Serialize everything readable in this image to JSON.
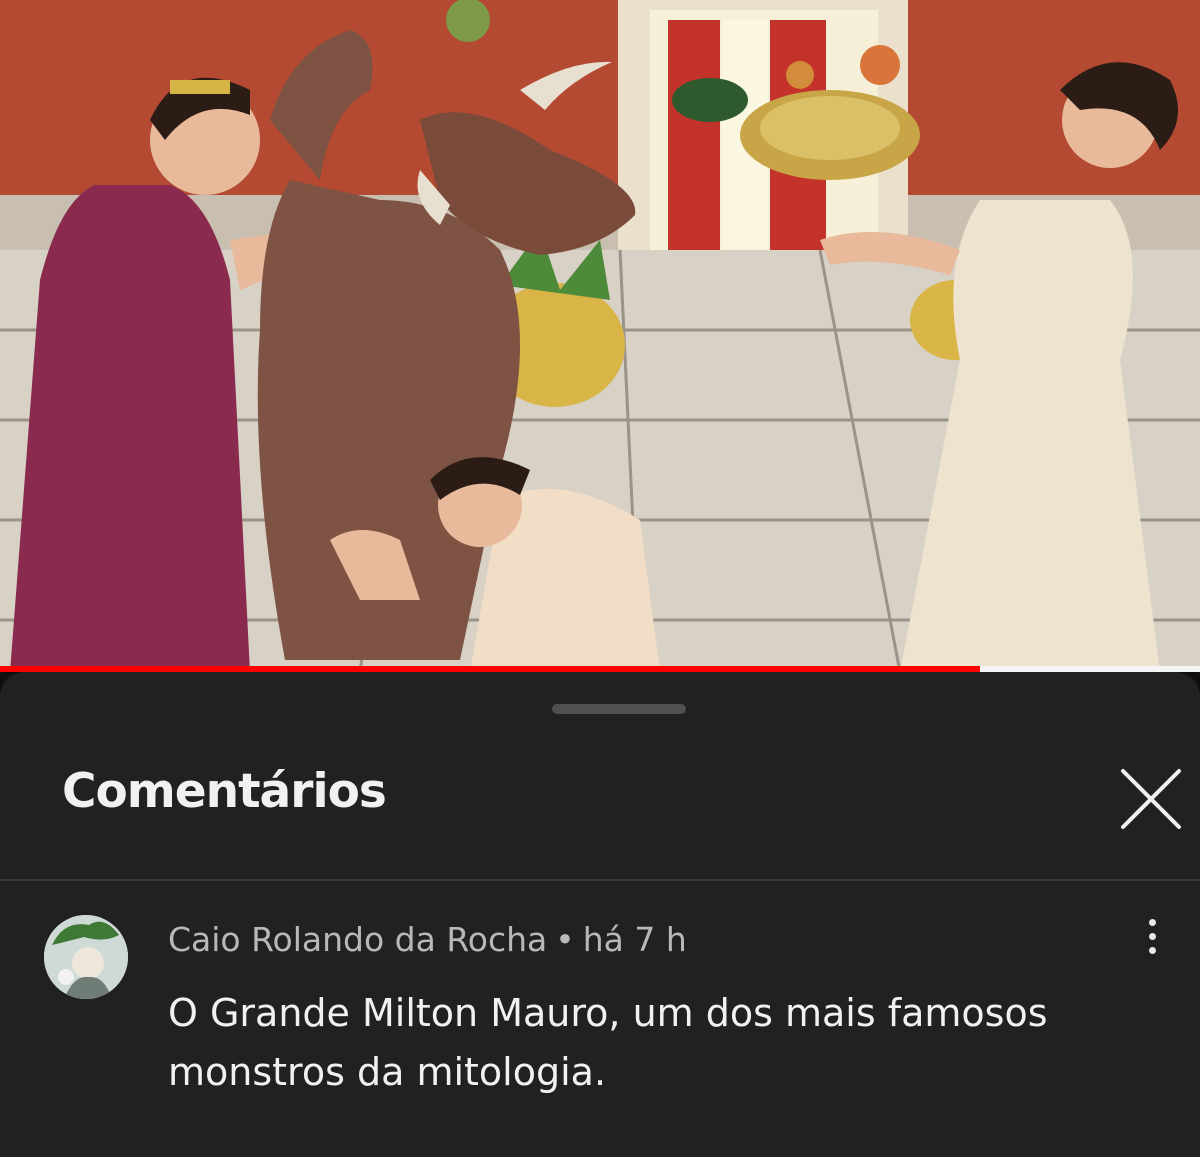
{
  "video": {
    "thumbnail_icon": "minotaur-illustration",
    "progress": 0.817,
    "colors": {
      "progress_played": "#ff0000",
      "progress_rest": "#f4f4f4"
    }
  },
  "comments_panel": {
    "title": "Comentários",
    "close_icon": "close-icon",
    "comment": {
      "author": "Caio Rolando da Rocha",
      "separator": "•",
      "time": "há 7 h",
      "text": "O Grande Milton Mauro, um dos mais famosos monstros da mitologia.",
      "menu_icon": "more-vertical-icon"
    }
  }
}
